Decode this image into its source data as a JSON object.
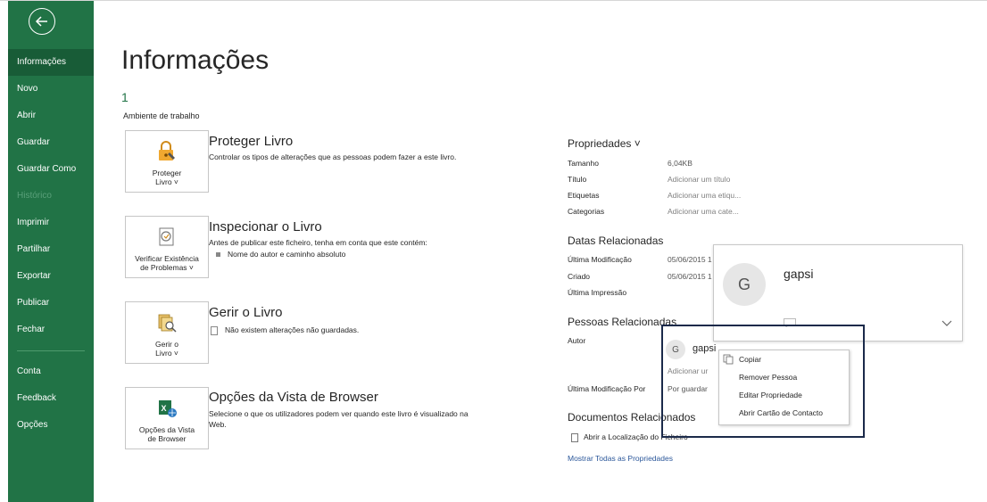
{
  "sidebar": {
    "items": [
      {
        "label": "Informações",
        "active": true
      },
      {
        "label": "Novo"
      },
      {
        "label": "Abrir"
      },
      {
        "label": "Guardar"
      },
      {
        "label": "Guardar Como"
      },
      {
        "label": "Histórico",
        "disabled": true
      },
      {
        "label": "Imprimir"
      },
      {
        "label": "Partilhar"
      },
      {
        "label": "Exportar"
      },
      {
        "label": "Publicar"
      },
      {
        "label": "Fechar"
      },
      {
        "label": "Conta"
      },
      {
        "label": "Feedback"
      },
      {
        "label": "Opções"
      }
    ]
  },
  "main": {
    "title": "Informações",
    "file_name": "1",
    "file_path": "Ambiente de trabalho",
    "sections": {
      "protect": {
        "tile_label_1": "Proteger",
        "tile_label_2": "Livro ˅",
        "heading": "Proteger Livro",
        "description": "Controlar os tipos de alterações que as pessoas podem fazer a este livro."
      },
      "inspect": {
        "tile_label_1": "Verificar Existência",
        "tile_label_2": "de Problemas ˅",
        "heading": "Inspecionar o Livro",
        "description": "Antes de publicar este ficheiro, tenha em conta que este contém:",
        "bullet": "Nome do autor e caminho absoluto"
      },
      "manage": {
        "tile_label_1": "Gerir o",
        "tile_label_2": "Livro ˅",
        "heading": "Gerir o Livro",
        "description": "Não existem alterações não guardadas."
      },
      "browser": {
        "tile_label_1": "Opções da Vista",
        "tile_label_2": "de Browser",
        "heading": "Opções da Vista de Browser",
        "description_1": "Selecione o que os utilizadores podem ver quando este livro é visualizado na",
        "description_2": "Web."
      }
    }
  },
  "properties": {
    "heading": "Propriedades ˅",
    "rows": [
      {
        "key": "Tamanho",
        "value": "6,04KB"
      },
      {
        "key": "Título",
        "value": "Adicionar um título"
      },
      {
        "key": "Etiquetas",
        "value": "Adicionar uma etiqu..."
      },
      {
        "key": "Categorias",
        "value": "Adicionar uma cate..."
      }
    ],
    "dates_heading": "Datas Relacionadas",
    "date_rows": [
      {
        "key": "Última Modificação",
        "value": "05/06/2015 1"
      },
      {
        "key": "Criado",
        "value": "05/06/2015 1"
      },
      {
        "key": "Última Impressão",
        "value": ""
      }
    ],
    "people_heading": "Pessoas Relacionadas",
    "author_key": "Autor",
    "author_initial": "G",
    "author_name": "gapsi",
    "add_author": "Adicionar ur",
    "last_modified_by_key": "Última Modificação Por",
    "last_modified_by_value": "Por guardar",
    "docs_heading": "Documentos Relacionados",
    "open_location": "Abrir a Localização do Ficheiro",
    "show_all": "Mostrar Todas as Propriedades"
  },
  "person_card": {
    "initial": "G",
    "name": "gapsi"
  },
  "context_menu": {
    "items": [
      {
        "label": "Copiar",
        "underline_char": "i"
      },
      {
        "label": "Remover Pessoa",
        "underline_char": "R"
      },
      {
        "label": "Editar Propriedade",
        "underline_char": "E"
      },
      {
        "label": "Abrir Cartão de Contacto",
        "underline_char": "n"
      }
    ]
  },
  "colors": {
    "sidebar_bg": "#217346",
    "sidebar_active": "#185c37",
    "accent_green": "#217346",
    "link_blue": "#2b579a",
    "highlight_border": "#1b2a4a"
  }
}
